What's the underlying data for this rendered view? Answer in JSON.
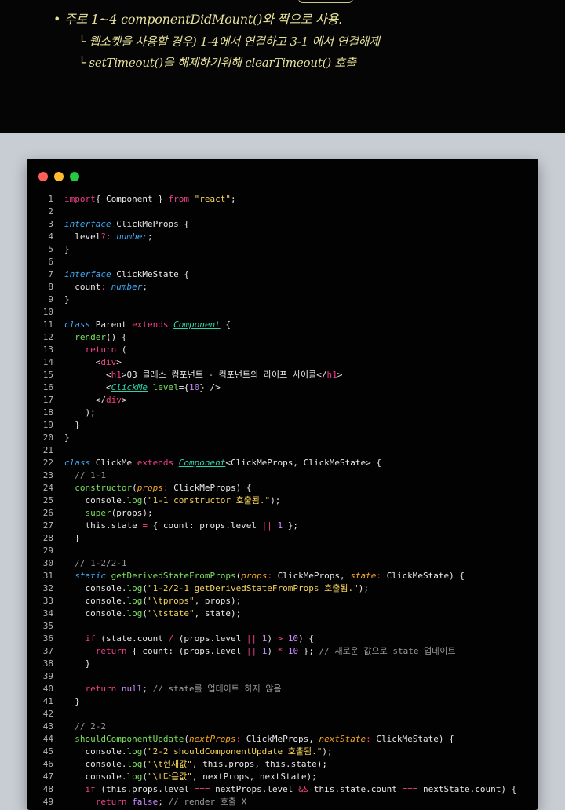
{
  "notes": {
    "line1": "• 주로 1~4 componentDidMount()와 짝으로 사용.",
    "line2": "└ 웹소켓을 사용할 경우) 1-4에서 연결하고 3-1 에서 연결해제",
    "line3": "└ setTimeout()을 해제하기위해 clearTimeout() 호출"
  },
  "window": {
    "controls": [
      {
        "name": "close",
        "color": "#ff5f57"
      },
      {
        "name": "minimize",
        "color": "#febc2e"
      },
      {
        "name": "maximize",
        "color": "#28c840"
      }
    ]
  },
  "code": {
    "lines": [
      {
        "n": "1",
        "t": [
          [
            "kw",
            "import"
          ],
          [
            "",
            "{ Component } "
          ],
          [
            "kw",
            "from"
          ],
          [
            "",
            " "
          ],
          [
            "st",
            "\"react\""
          ],
          [
            "",
            ";"
          ]
        ]
      },
      {
        "n": "2",
        "t": []
      },
      {
        "n": "3",
        "t": [
          [
            "ty",
            "interface"
          ],
          [
            "",
            " ClickMeProps {"
          ]
        ]
      },
      {
        "n": "4",
        "t": [
          [
            "",
            "  level"
          ],
          [
            "op",
            "?:"
          ],
          [
            "",
            " "
          ],
          [
            "ty",
            "number"
          ],
          [
            "",
            ";"
          ]
        ]
      },
      {
        "n": "5",
        "t": [
          [
            "",
            "}"
          ]
        ]
      },
      {
        "n": "6",
        "t": []
      },
      {
        "n": "7",
        "t": [
          [
            "ty",
            "interface"
          ],
          [
            "",
            " ClickMeState {"
          ]
        ]
      },
      {
        "n": "8",
        "t": [
          [
            "",
            "  count"
          ],
          [
            "op",
            ":"
          ],
          [
            "",
            " "
          ],
          [
            "ty",
            "number"
          ],
          [
            "",
            ";"
          ]
        ]
      },
      {
        "n": "9",
        "t": [
          [
            "",
            "}"
          ]
        ]
      },
      {
        "n": "10",
        "t": []
      },
      {
        "n": "11",
        "t": [
          [
            "ty",
            "class"
          ],
          [
            "",
            " Parent "
          ],
          [
            "kw",
            "extends"
          ],
          [
            "",
            " "
          ],
          [
            "cl",
            "Component"
          ],
          [
            "",
            " {"
          ]
        ]
      },
      {
        "n": "12",
        "t": [
          [
            "",
            "  "
          ],
          [
            "fn",
            "render"
          ],
          [
            "",
            "() {"
          ]
        ]
      },
      {
        "n": "13",
        "t": [
          [
            "",
            "    "
          ],
          [
            "kw",
            "return"
          ],
          [
            "",
            " ("
          ]
        ]
      },
      {
        "n": "14",
        "t": [
          [
            "",
            "      <"
          ],
          [
            "tg",
            "div"
          ],
          [
            "",
            ">"
          ]
        ]
      },
      {
        "n": "15",
        "t": [
          [
            "",
            "        <"
          ],
          [
            "tg",
            "h1"
          ],
          [
            "",
            ">03 클래스 컴포넌트 - 컴포넌트의 라이프 사이클</"
          ],
          [
            "tg",
            "h1"
          ],
          [
            "",
            ">"
          ]
        ]
      },
      {
        "n": "16",
        "t": [
          [
            "",
            "        <"
          ],
          [
            "cl",
            "ClickMe"
          ],
          [
            "",
            " "
          ],
          [
            "fn",
            "level"
          ],
          [
            "",
            "={"
          ],
          [
            "nu",
            "10"
          ],
          [
            "",
            "} />"
          ]
        ]
      },
      {
        "n": "17",
        "t": [
          [
            "",
            "      </"
          ],
          [
            "tg",
            "div"
          ],
          [
            "",
            ">"
          ]
        ]
      },
      {
        "n": "18",
        "t": [
          [
            "",
            "    );"
          ]
        ]
      },
      {
        "n": "19",
        "t": [
          [
            "",
            "  }"
          ]
        ]
      },
      {
        "n": "20",
        "t": [
          [
            "",
            "}"
          ]
        ]
      },
      {
        "n": "21",
        "t": []
      },
      {
        "n": "22",
        "t": [
          [
            "ty",
            "class"
          ],
          [
            "",
            " ClickMe "
          ],
          [
            "kw",
            "extends"
          ],
          [
            "",
            " "
          ],
          [
            "cl",
            "Component"
          ],
          [
            "",
            "<ClickMeProps, ClickMeState> {"
          ]
        ]
      },
      {
        "n": "23",
        "t": [
          [
            "cm",
            "  // 1-1"
          ]
        ]
      },
      {
        "n": "24",
        "t": [
          [
            "",
            "  "
          ],
          [
            "fn",
            "constructor"
          ],
          [
            "",
            "("
          ],
          [
            "pa",
            "props"
          ],
          [
            "op",
            ":"
          ],
          [
            "",
            " ClickMeProps) {"
          ]
        ]
      },
      {
        "n": "25",
        "t": [
          [
            "",
            "    console."
          ],
          [
            "fn",
            "log"
          ],
          [
            "",
            "("
          ],
          [
            "st",
            "\"1-1 constructor 호출됨.\""
          ],
          [
            "",
            ");"
          ]
        ]
      },
      {
        "n": "26",
        "t": [
          [
            "",
            "    "
          ],
          [
            "fn",
            "super"
          ],
          [
            "",
            "(props);"
          ]
        ]
      },
      {
        "n": "27",
        "t": [
          [
            "",
            "    this.state "
          ],
          [
            "op",
            "="
          ],
          [
            "",
            " { count: props.level "
          ],
          [
            "op",
            "||"
          ],
          [
            "",
            " "
          ],
          [
            "nu",
            "1"
          ],
          [
            "",
            " };"
          ]
        ]
      },
      {
        "n": "28",
        "t": [
          [
            "",
            "  }"
          ]
        ]
      },
      {
        "n": "29",
        "t": []
      },
      {
        "n": "30",
        "t": [
          [
            "cm",
            "  // 1-2/2-1"
          ]
        ]
      },
      {
        "n": "31",
        "t": [
          [
            "",
            "  "
          ],
          [
            "ty",
            "static"
          ],
          [
            "",
            " "
          ],
          [
            "fn",
            "getDerivedStateFromProps"
          ],
          [
            "",
            "("
          ],
          [
            "pa",
            "props"
          ],
          [
            "op",
            ":"
          ],
          [
            "",
            " ClickMeProps, "
          ],
          [
            "pa",
            "state"
          ],
          [
            "op",
            ":"
          ],
          [
            "",
            " ClickMeState) {"
          ]
        ]
      },
      {
        "n": "32",
        "t": [
          [
            "",
            "    console."
          ],
          [
            "fn",
            "log"
          ],
          [
            "",
            "("
          ],
          [
            "st",
            "\"1-2/2-1 getDerivedStateFromProps 호출됨.\""
          ],
          [
            "",
            ");"
          ]
        ]
      },
      {
        "n": "33",
        "t": [
          [
            "",
            "    console."
          ],
          [
            "fn",
            "log"
          ],
          [
            "",
            "("
          ],
          [
            "st",
            "\"\\tprops\""
          ],
          [
            "",
            ", props);"
          ]
        ]
      },
      {
        "n": "34",
        "t": [
          [
            "",
            "    console."
          ],
          [
            "fn",
            "log"
          ],
          [
            "",
            "("
          ],
          [
            "st",
            "\"\\tstate\""
          ],
          [
            "",
            ", state);"
          ]
        ]
      },
      {
        "n": "35",
        "t": []
      },
      {
        "n": "36",
        "t": [
          [
            "",
            "    "
          ],
          [
            "kw",
            "if"
          ],
          [
            "",
            " (state.count "
          ],
          [
            "op",
            "/"
          ],
          [
            "",
            " (props.level "
          ],
          [
            "op",
            "||"
          ],
          [
            "",
            " "
          ],
          [
            "nu",
            "1"
          ],
          [
            "",
            ") "
          ],
          [
            "op",
            ">"
          ],
          [
            "",
            " "
          ],
          [
            "nu",
            "10"
          ],
          [
            "",
            ") {"
          ]
        ]
      },
      {
        "n": "37",
        "t": [
          [
            "",
            "      "
          ],
          [
            "kw",
            "return"
          ],
          [
            "",
            " { count: (props.level "
          ],
          [
            "op",
            "||"
          ],
          [
            "",
            " "
          ],
          [
            "nu",
            "1"
          ],
          [
            "",
            ") "
          ],
          [
            "op",
            "*"
          ],
          [
            "",
            " "
          ],
          [
            "nu",
            "10"
          ],
          [
            "",
            " }; "
          ],
          [
            "cm",
            "// 새로운 값으로 state 업데이트"
          ]
        ]
      },
      {
        "n": "38",
        "t": [
          [
            "",
            "    }"
          ]
        ]
      },
      {
        "n": "39",
        "t": []
      },
      {
        "n": "40",
        "t": [
          [
            "",
            "    "
          ],
          [
            "kw",
            "return"
          ],
          [
            "",
            " "
          ],
          [
            "nu",
            "null"
          ],
          [
            "",
            "; "
          ],
          [
            "cm",
            "// state를 업데이트 하지 않음"
          ]
        ]
      },
      {
        "n": "41",
        "t": [
          [
            "",
            "  }"
          ]
        ]
      },
      {
        "n": "42",
        "t": []
      },
      {
        "n": "43",
        "t": [
          [
            "cm",
            "  // 2-2"
          ]
        ]
      },
      {
        "n": "44",
        "t": [
          [
            "",
            "  "
          ],
          [
            "fn",
            "shouldComponentUpdate"
          ],
          [
            "",
            "("
          ],
          [
            "pa",
            "nextProps"
          ],
          [
            "op",
            ":"
          ],
          [
            "",
            " ClickMeProps, "
          ],
          [
            "pa",
            "nextState"
          ],
          [
            "op",
            ":"
          ],
          [
            "",
            " ClickMeState) {"
          ]
        ]
      },
      {
        "n": "45",
        "t": [
          [
            "",
            "    console."
          ],
          [
            "fn",
            "log"
          ],
          [
            "",
            "("
          ],
          [
            "st",
            "\"2-2 shouldComponentUpdate 호출됨.\""
          ],
          [
            "",
            ");"
          ]
        ]
      },
      {
        "n": "46",
        "t": [
          [
            "",
            "    console."
          ],
          [
            "fn",
            "log"
          ],
          [
            "",
            "("
          ],
          [
            "st",
            "\"\\t현재값\""
          ],
          [
            "",
            ", this.props, this.state);"
          ]
        ]
      },
      {
        "n": "47",
        "t": [
          [
            "",
            "    console."
          ],
          [
            "fn",
            "log"
          ],
          [
            "",
            "("
          ],
          [
            "st",
            "\"\\t다음값\""
          ],
          [
            "",
            ", nextProps, nextState);"
          ]
        ]
      },
      {
        "n": "48",
        "t": [
          [
            "",
            "    "
          ],
          [
            "kw",
            "if"
          ],
          [
            "",
            " (this.props.level "
          ],
          [
            "op",
            "==="
          ],
          [
            "",
            " nextProps.level "
          ],
          [
            "op",
            "&&"
          ],
          [
            "",
            " this.state.count "
          ],
          [
            "op",
            "==="
          ],
          [
            "",
            " nextState.count) {"
          ]
        ]
      },
      {
        "n": "49",
        "t": [
          [
            "",
            "      "
          ],
          [
            "kw",
            "return"
          ],
          [
            "",
            " "
          ],
          [
            "nu",
            "false"
          ],
          [
            "",
            "; "
          ],
          [
            "cm",
            "// render 호출 X"
          ]
        ]
      }
    ]
  }
}
